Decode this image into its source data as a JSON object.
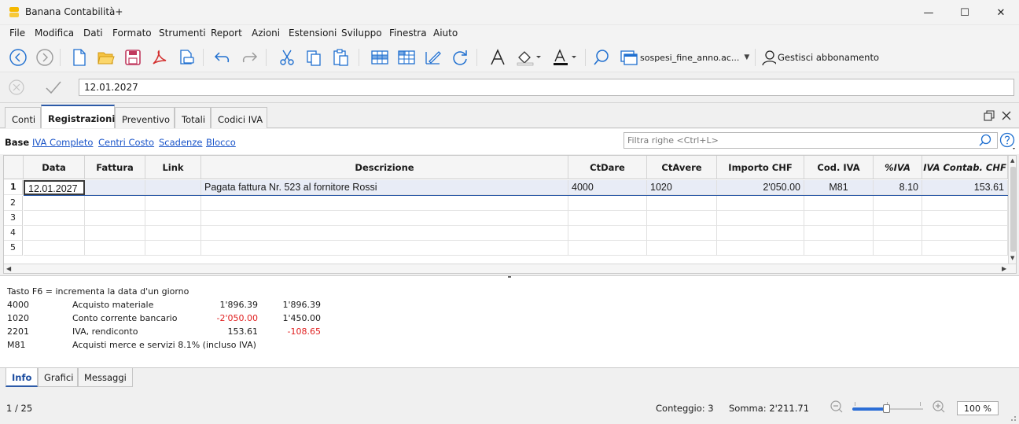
{
  "window": {
    "title": "Banana Contabilità+",
    "minimize_glyph": "—",
    "maximize_glyph": "☐",
    "close_glyph": "✕"
  },
  "menu": [
    "File",
    "Modifica",
    "Dati",
    "Formato",
    "Strumenti",
    "Report",
    "Azioni",
    "Estensioni",
    "Sviluppo",
    "Finestra",
    "Aiuto"
  ],
  "toolbar": {
    "file_selector": "sospesi_fine_anno.ac...",
    "subscription_label": "Gestisci abbonamento"
  },
  "formula_bar": {
    "value": "12.01.2027"
  },
  "tabs": [
    "Conti",
    "Registrazioni",
    "Preventivo",
    "Totali",
    "Codici IVA"
  ],
  "views": {
    "base": "Base",
    "links": [
      "IVA Completo",
      "Centri Costo",
      "Scadenze",
      "Blocco"
    ],
    "filter_placeholder": "Filtra righe <Ctrl+L>"
  },
  "grid": {
    "columns": [
      "Data",
      "Fattura",
      "Link",
      "Descrizione",
      "CtDare",
      "CtAvere",
      "Importo CHF",
      "Cod. IVA",
      "%IVA",
      "IVA Contab. CHF"
    ],
    "rows": [
      {
        "num": "1",
        "data": "12.01.2027",
        "fattura": "",
        "link": "",
        "descrizione": "Pagata fattura Nr. 523 al fornitore Rossi",
        "ctdare": "4000",
        "ctavere": "1020",
        "importo": "2'050.00",
        "codiva": "M81",
        "piva": "8.10",
        "ivacontab": "153.61"
      },
      {
        "num": "2"
      },
      {
        "num": "3"
      },
      {
        "num": "4"
      },
      {
        "num": "5"
      }
    ]
  },
  "info": {
    "hint": "Tasto F6 = incrementa la data d'un giorno",
    "lines": [
      {
        "code": "4000",
        "desc": "Acquisto materiale",
        "v1": "1'896.39",
        "v2": "1'896.39"
      },
      {
        "code": "1020",
        "desc": "Conto corrente bancario",
        "v1": "-2'050.00",
        "v2": "1'450.00"
      },
      {
        "code": "2201",
        "desc": "IVA, rendiconto",
        "v1": "153.61",
        "v2": "-108.65"
      },
      {
        "code": "M81",
        "desc": "Acquisti merce e servizi 8.1% (incluso IVA)",
        "v1": "",
        "v2": ""
      }
    ]
  },
  "info_tabs": [
    "Info",
    "Grafici",
    "Messaggi"
  ],
  "status": {
    "position": "1 / 25",
    "count": "Conteggio: 3",
    "sum": "Somma: 2'211.71",
    "zoom": "100 %",
    "zoom_level_fraction": 0.48
  },
  "colors": {
    "accent": "#2c5aa8",
    "link": "#1b55c9",
    "negative": "#e02020",
    "logo": "#f5b800"
  }
}
